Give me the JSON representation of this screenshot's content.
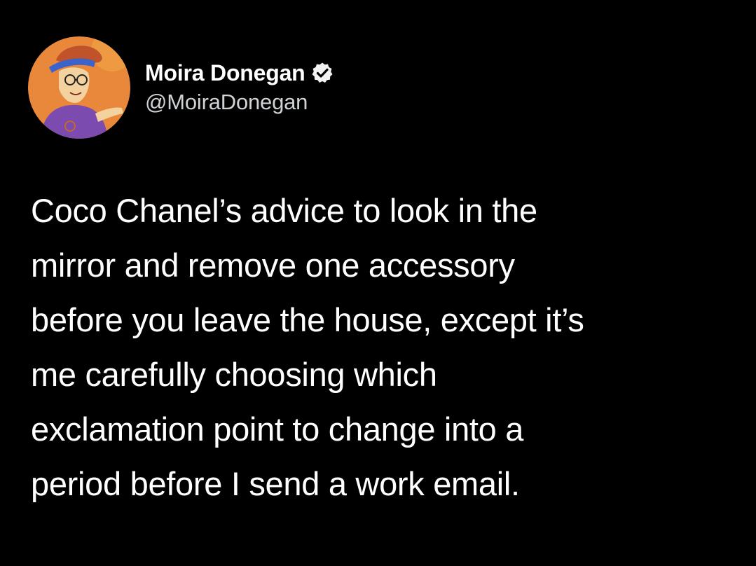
{
  "author": {
    "display_name": "Moira Donegan",
    "handle": "@MoiraDonegan",
    "verified": true,
    "avatar_icon": "cartoon-avatar-icon",
    "verified_icon": "verified-badge-icon"
  },
  "tweet": {
    "lines": [
      "Coco Chanel’s advice to look in the",
      "mirror and remove one accessory",
      "before you leave the house, except it’s",
      "me carefully choosing which",
      "exclamation point to change into a",
      "period before I send a work email."
    ]
  },
  "colors": {
    "background": "#000000",
    "text": "#ffffff",
    "handle": "#d0d3d6",
    "avatar_bg": "#e9873a"
  }
}
